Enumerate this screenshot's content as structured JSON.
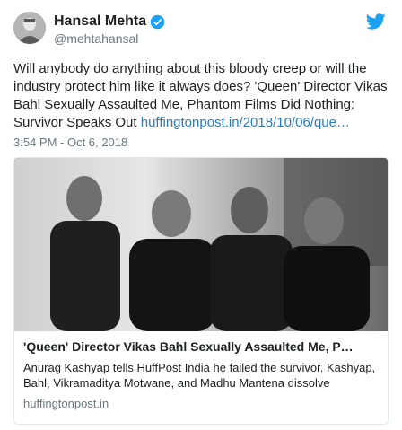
{
  "author": {
    "display_name": "Hansal Mehta",
    "handle": "@mehtahansal"
  },
  "tweet": {
    "text": "Will anybody do anything about this bloody creep or will the industry protect him like it always does? 'Queen' Director Vikas Bahl Sexually Assaulted Me, Phantom Films Did Nothing: Survivor Speaks Out ",
    "link": "huffingtonpost.in/2018/10/06/que…",
    "timestamp": "3:54 PM - Oct 6, 2018"
  },
  "card": {
    "title": "'Queen' Director Vikas Bahl Sexually Assaulted Me, P…",
    "description": "Anurag Kashyap tells HuffPost India he failed the survivor. Kashyap, Bahl, Vikramaditya Motwane, and Madhu Mantena dissolve",
    "domain": "huffingtonpost.in"
  },
  "colors": {
    "link": "#2b7bb9",
    "twitter_blue": "#1da1f2",
    "muted": "#697882"
  },
  "icons": [
    "avatar-photo",
    "verified-badge-icon",
    "twitter-bird-icon"
  ]
}
